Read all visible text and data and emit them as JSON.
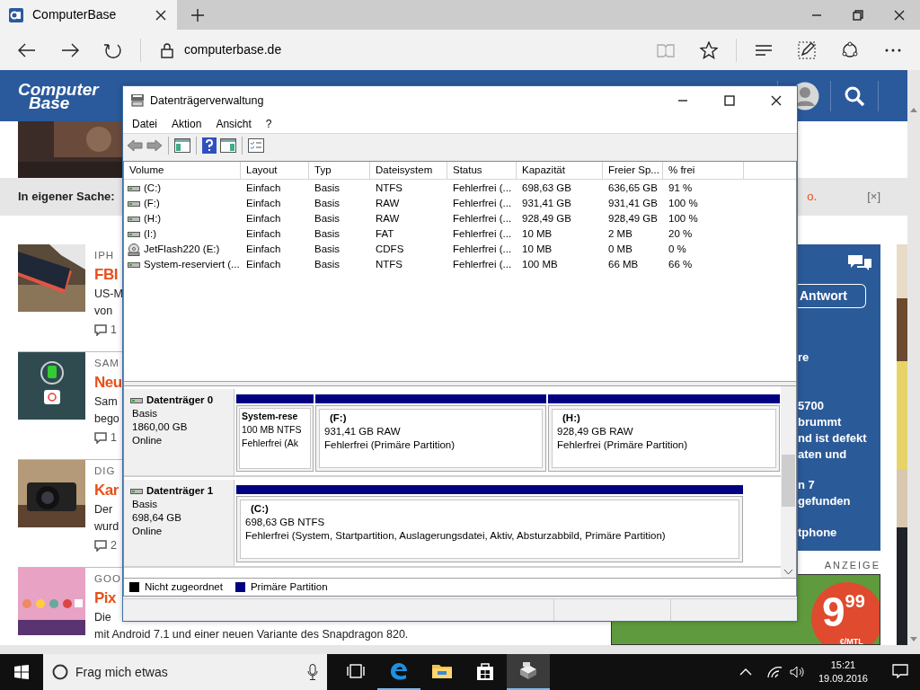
{
  "browser": {
    "tab": {
      "title": "ComputerBase"
    },
    "address": "computerbase.de"
  },
  "site": {
    "logo": [
      "Computer",
      "Base"
    ],
    "notice": {
      "label": "In eigener Sache:",
      "link": "o.",
      "close": "[×]"
    },
    "articles": [
      {
        "category": "IPH",
        "title": "FBI",
        "lines": [
          "US-M",
          "von"
        ],
        "comments": "1"
      },
      {
        "category": "SAM",
        "title": "Neu",
        "lines": [
          "Sam",
          "bego"
        ],
        "comments": "1"
      },
      {
        "category": "DIG",
        "title": "Kar",
        "lines": [
          "Der",
          "wurd"
        ],
        "comments": "2"
      },
      {
        "category": "GOO",
        "title": "Pix",
        "lines": [
          "Die",
          "mit Android 7.1 und einer neuen Variante des Snapdragon 820."
        ]
      }
    ],
    "forum_panel": {
      "button": "Antwort",
      "lines": [
        "re",
        "5700",
        "brummt",
        "nd ist defekt",
        "aten und",
        "n 7",
        "gefunden",
        "tphone"
      ]
    },
    "ad": {
      "label": "ANZEIGE",
      "price": "9",
      "cents": "99",
      "unit": "€/MTL"
    }
  },
  "dialog": {
    "title": "Datenträgerverwaltung",
    "menu": [
      "Datei",
      "Aktion",
      "Ansicht",
      "?"
    ],
    "columns": [
      "Volume",
      "Layout",
      "Typ",
      "Dateisystem",
      "Status",
      "Kapazität",
      "Freier Sp...",
      "% frei"
    ],
    "volumes": [
      {
        "kind": "disk",
        "cells": [
          "(C:)",
          "Einfach",
          "Basis",
          "NTFS",
          "Fehlerfrei (...",
          "698,63 GB",
          "636,65 GB",
          "91 %"
        ]
      },
      {
        "kind": "disk",
        "cells": [
          "(F:)",
          "Einfach",
          "Basis",
          "RAW",
          "Fehlerfrei (...",
          "931,41 GB",
          "931,41 GB",
          "100 %"
        ]
      },
      {
        "kind": "disk",
        "cells": [
          "(H:)",
          "Einfach",
          "Basis",
          "RAW",
          "Fehlerfrei (...",
          "928,49 GB",
          "928,49 GB",
          "100 %"
        ]
      },
      {
        "kind": "disk",
        "cells": [
          "(I:)",
          "Einfach",
          "Basis",
          "FAT",
          "Fehlerfrei (...",
          "10 MB",
          "2 MB",
          "20 %"
        ]
      },
      {
        "kind": "cd",
        "cells": [
          "JetFlash220 (E:)",
          "Einfach",
          "Basis",
          "CDFS",
          "Fehlerfrei (...",
          "10 MB",
          "0 MB",
          "0 %"
        ]
      },
      {
        "kind": "disk",
        "cells": [
          "System-reserviert (...",
          "Einfach",
          "Basis",
          "NTFS",
          "Fehlerfrei (...",
          "100 MB",
          "66 MB",
          "66 %"
        ]
      }
    ],
    "disks": [
      {
        "name": "Datenträger 0",
        "type": "Basis",
        "size": "1860,00 GB",
        "state": "Online",
        "partitions": [
          {
            "label": "System-rese",
            "size": "100 MB NTFS",
            "status": "Fehlerfrei (Ak"
          },
          {
            "label": "(F:)",
            "size": "931,41 GB RAW",
            "status": "Fehlerfrei (Primäre Partition)"
          },
          {
            "label": "(H:)",
            "size": "928,49 GB RAW",
            "status": "Fehlerfrei (Primäre Partition)"
          }
        ]
      },
      {
        "name": "Datenträger 1",
        "type": "Basis",
        "size": "698,64 GB",
        "state": "Online",
        "partitions": [
          {
            "label": "(C:)",
            "size": "698,63 GB NTFS",
            "status": "Fehlerfrei (System, Startpartition, Auslagerungsdatei, Aktiv, Absturzabbild, Primäre Partition)"
          }
        ]
      }
    ],
    "legend": [
      {
        "label": "Nicht zugeordnet",
        "color": "#000000"
      },
      {
        "label": "Primäre Partition",
        "color": "#000080"
      }
    ]
  },
  "taskbar": {
    "search": "Frag mich etwas",
    "apps": [
      {
        "kind": "edge",
        "selected": false,
        "running": true
      },
      {
        "kind": "explorer",
        "selected": false,
        "running": false
      },
      {
        "kind": "store",
        "selected": false,
        "running": false
      },
      {
        "kind": "diskmgmt",
        "selected": true,
        "running": true
      }
    ],
    "time": "15:21",
    "date": "19.09.2016"
  }
}
